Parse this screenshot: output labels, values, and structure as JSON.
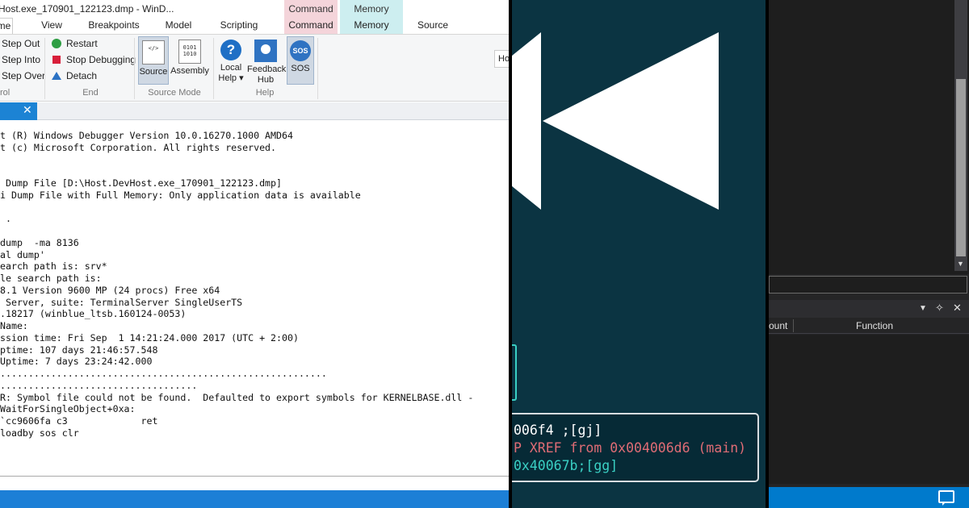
{
  "windbg": {
    "title": "Host.exe_170901_122123.dmp - WinD...",
    "tabs": [
      "me",
      "View",
      "Breakpoints",
      "Model",
      "Scripting",
      "Command",
      "Source"
    ],
    "context_groups": [
      {
        "group": "Command",
        "tab": "Command",
        "color": "#f4d4da"
      },
      {
        "group": "Memory",
        "tab": "Memory",
        "color": "#cdeef0"
      }
    ],
    "ribbon": {
      "step_out": "Step Out",
      "step_into": "Step Into",
      "step_over": "Step Over",
      "control_group": "rol",
      "restart": "Restart",
      "stop": "Stop Debugging",
      "detach": "Detach",
      "end_group": "End",
      "source": "Source",
      "assembly": "Assembly",
      "source_mode_group": "Source Mode",
      "local_help": "Local",
      "local_help2": "Help ▾",
      "feedback": "Feedback",
      "feedback2": "Hub",
      "sos": "SOS",
      "help_group": "Help",
      "ho": "Ho"
    },
    "output_lines": [
      "t (R) Windows Debugger Version 10.0.16270.1000 AMD64",
      "t (c) Microsoft Corporation. All rights reserved.",
      "",
      "",
      " Dump File [D:\\Host.DevHost.exe_170901_122123.dmp]",
      "i Dump File with Full Memory: Only application data is available",
      "",
      " .",
      "",
      "dump  -ma 8136",
      "al dump'",
      "earch path is: srv*",
      "le search path is:",
      "8.1 Version 9600 MP (24 procs) Free x64",
      " Server, suite: TerminalServer SingleUserTS",
      ".18217 (winblue_ltsb.160124-0053)",
      "Name:",
      "ssion time: Fri Sep  1 14:21:24.000 2017 (UTC + 2:00)",
      "ptime: 107 days 21:46:57.548",
      "Uptime: 7 days 23:24:42.000",
      "..........................................................",
      "...................................",
      "R: Symbol file could not be found.  Defaulted to export symbols for KERNELBASE.dll -",
      "WaitForSingleObject+0xa:",
      "`cc9606fa c3             ret",
      "loadby sos clr"
    ]
  },
  "rewind": {
    "bg_color": "#0b3442",
    "icon": "rewind-icon",
    "disasm": [
      {
        "text": "006f4 ;[gj]",
        "color": "#ffffff"
      },
      {
        "text": "P XREF from 0x004006d6 (main)",
        "color": "#e06c75"
      },
      {
        "text": "0x40067b;[gg]",
        "color": "#3ad0c4"
      }
    ]
  },
  "ide": {
    "headers": {
      "count": "ount",
      "function": "Function"
    },
    "accent": "#007acc"
  }
}
